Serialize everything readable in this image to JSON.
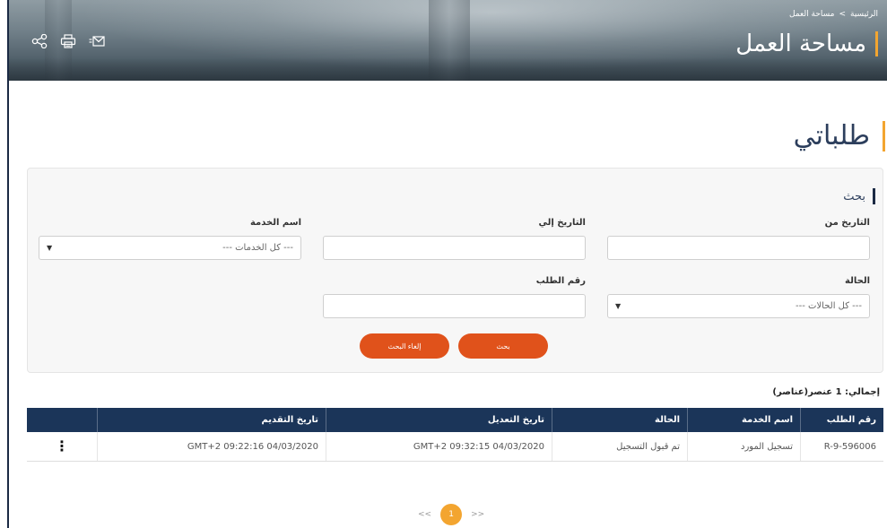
{
  "header": {
    "breadcrumb": {
      "home": "الرئيسية",
      "separator": ">",
      "current": "مساحة العمل"
    },
    "title": "مساحة العمل",
    "tools": {
      "share_icon": "share-icon",
      "print_icon": "print-icon",
      "email_icon": "email-icon"
    }
  },
  "page": {
    "title": "طلباتي"
  },
  "search": {
    "heading": "بحث",
    "fields": {
      "date_from": {
        "label": "التاريخ من",
        "value": ""
      },
      "date_to": {
        "label": "التاريخ إلي",
        "value": ""
      },
      "service_name": {
        "label": "اسم الخدمة",
        "value": "--- كل الخدمات ---"
      },
      "status": {
        "label": "الحالة",
        "value": "--- كل الحالات ---"
      },
      "request_number": {
        "label": "رقم الطلب",
        "value": ""
      }
    },
    "buttons": {
      "search": "بحث",
      "cancel": "إلغاء البحث"
    }
  },
  "results": {
    "total": "إجمالي: 1 عنصر(عناصر)",
    "columns": [
      "رقم الطلب",
      "اسم الخدمة",
      "الحالة",
      "تاريخ التعديل",
      "تاريخ التقديم"
    ],
    "rows": [
      {
        "request_number": "R-9-596006",
        "service_name": "تسجيل المورد",
        "status": "تم قبول التسجيل",
        "modified": "GMT+2 09:32:15 04/03/2020",
        "submitted": "GMT+2 09:22:16 04/03/2020",
        "actions": "⋮"
      }
    ]
  },
  "pagination": {
    "prev": "<<",
    "current": "1",
    "next": ">>"
  },
  "colors": {
    "accent": "#f3a530",
    "primary": "#1b3559",
    "button": "#e0521b"
  }
}
